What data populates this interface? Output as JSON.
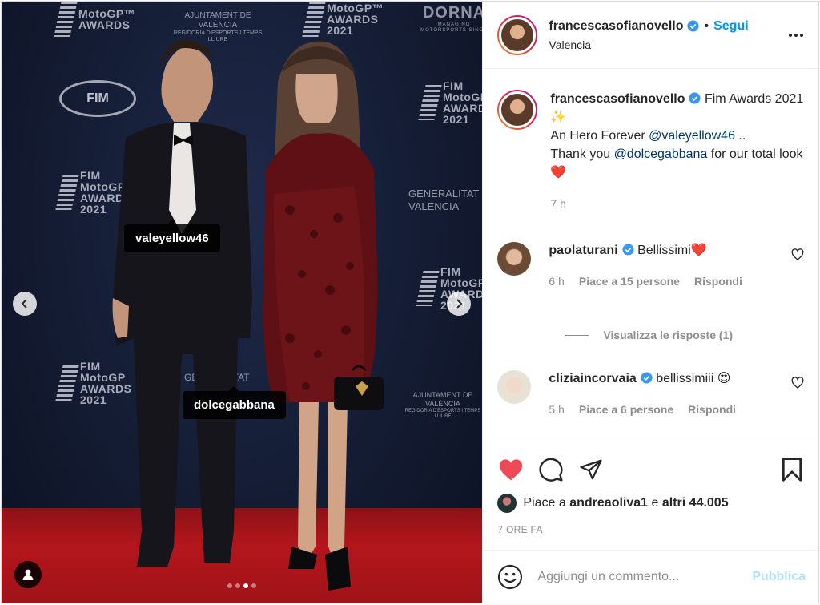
{
  "photo": {
    "tags": {
      "tag1": "valeyellow46",
      "tag2": "dolcegabbana"
    },
    "backdrop": {
      "top_awards_1": "MotoGP™",
      "top_awards_2": "AWARDS",
      "top_awards_3": "2021",
      "ajuntament": "AJUNTAMENT DE VALÈNCIA",
      "ajuntament_sub": "REGIDORIA D'ESPORTS I TEMPS LLIURE",
      "dorna": "DORNA",
      "dorna_sub": "MANAGING MOTORSPORTS SINCE",
      "fim": "FIM",
      "fim_motogp_1": "FIM",
      "fim_motogp_2": "MotoGP",
      "fim_motogp_3": "AWARDS",
      "fim_motogp_4": "2021",
      "generalitat_1": "GENERALITAT",
      "generalitat_2": "VALENCIA",
      "bottom_gen": "GENERALITAT",
      "ajuntament_bottom": "AJUNTAMENT DE VALÈNCIA",
      "ajuntament_bottom_sub": "REGIDORIA D'ESPORTS I TEMPS LLIURE"
    },
    "carousel_dots": 4,
    "active_dot": 3
  },
  "header": {
    "username": "francescasofianovello",
    "separator": "•",
    "follow_label": "Segui",
    "location": "Valencia"
  },
  "caption": {
    "username": "francescasofianovello",
    "text_1": "Fim Awards 2021 ✨",
    "text_2": "An Hero Forever ",
    "mention_1": "@valeyellow46",
    "text_3": " ..",
    "text_4": "Thank you ",
    "mention_2": "@dolcegabbana",
    "text_5": " for our total look❤️",
    "time": "7 h"
  },
  "comments": [
    {
      "username": "paolaturani",
      "text": "Bellissimi❤️",
      "time": "6 h",
      "likes": "Piace a 15 persone",
      "reply": "Rispondi"
    },
    {
      "username": "cliziaincorvaia",
      "text": "bellissimiii 😍",
      "time": "5 h",
      "likes": "Piace a 6 persone",
      "reply": "Rispondi"
    }
  ],
  "view_replies": "Visualizza le risposte (1)",
  "likes": {
    "prefix": "Piace a ",
    "user": "andreaoliva1",
    "middle": " e ",
    "others": "altri 44.005"
  },
  "posted_ago": "7 ORE FA",
  "add_comment": {
    "placeholder": "Aggiungi un commento...",
    "publish": "Pubblica"
  },
  "colors": {
    "like_red": "#ed4956",
    "link_blue": "#0095f6",
    "mention": "#00376b"
  }
}
